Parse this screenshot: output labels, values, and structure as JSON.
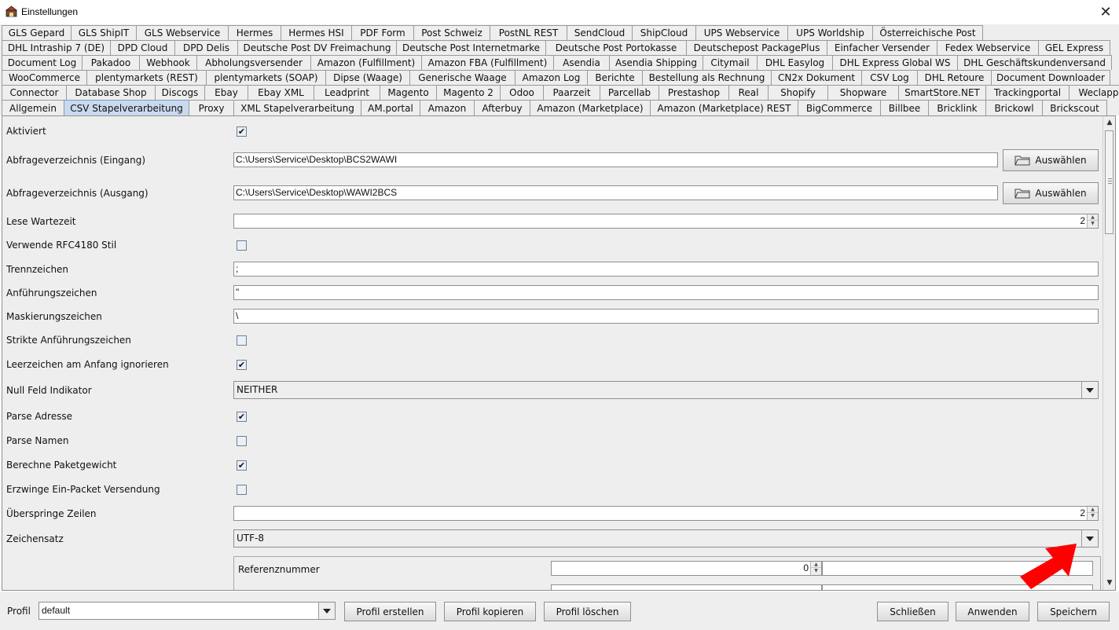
{
  "window": {
    "title": "Einstellungen",
    "close_glyph": "✕",
    "app_icon": "app-icon"
  },
  "tabs": {
    "row1": [
      "GLS Gepard",
      "GLS ShipIT",
      "GLS Webservice",
      "Hermes",
      "Hermes HSI",
      "PDF Form",
      "Post Schweiz",
      "PostNL REST",
      "SendCloud",
      "ShipCloud",
      "UPS Webservice",
      "UPS Worldship",
      "Österreichische Post"
    ],
    "row2": [
      "DHL Intraship 7 (DE)",
      "DPD Cloud",
      "DPD Delis",
      "Deutsche Post DV Freimachung",
      "Deutsche Post Internetmarke",
      "Deutsche Post Portokasse",
      "Deutschepost PackagePlus",
      "Einfacher Versender",
      "Fedex Webservice",
      "GEL Express"
    ],
    "row3": [
      "Document Log",
      "Pakadoo",
      "Webhook",
      "Abholungsversender",
      "Amazon (Fulfillment)",
      "Amazon FBA (Fulfillment)",
      "Asendia",
      "Asendia Shipping",
      "Citymail",
      "DHL Easylog",
      "DHL Express Global WS",
      "DHL Geschäftskundenversand"
    ],
    "row4": [
      "WooCommerce",
      "plentymarkets (REST)",
      "plentymarkets (SOAP)",
      "Dipse (Waage)",
      "Generische Waage",
      "Amazon Log",
      "Berichte",
      "Bestellung als Rechnung",
      "CN2x Dokument",
      "CSV Log",
      "DHL Retoure",
      "Document Downloader"
    ],
    "row5": [
      "Connector",
      "Database Shop",
      "Discogs",
      "Ebay",
      "Ebay XML",
      "Leadprint",
      "Magento",
      "Magento 2",
      "Odoo",
      "Paarzeit",
      "Parcellab",
      "Prestashop",
      "Real",
      "Shopify",
      "Shopware",
      "SmartStore.NET",
      "Trackingportal",
      "Weclapp"
    ],
    "row6": [
      "Allgemein",
      "CSV Stapelverarbeitung",
      "Proxy",
      "XML Stapelverarbeitung",
      "AM.portal",
      "Amazon",
      "Afterbuy",
      "Amazon (Marketplace)",
      "Amazon (Marketplace) REST",
      "BigCommerce",
      "Billbee",
      "Bricklink",
      "Brickowl",
      "Brickscout"
    ],
    "active": "CSV Stapelverarbeitung"
  },
  "form": {
    "aktiviert": {
      "label": "Aktiviert",
      "checked": true
    },
    "eingang": {
      "label": "Abfrageverzeichnis (Eingang)",
      "value": "C:\\Users\\Service\\Desktop\\BCS2WAWI",
      "button": "Auswählen"
    },
    "ausgang": {
      "label": "Abfrageverzeichnis (Ausgang)",
      "value": "C:\\Users\\Service\\Desktop\\WAWI2BCS",
      "button": "Auswählen"
    },
    "lese_wartezeit": {
      "label": "Lese Wartezeit",
      "value": "2"
    },
    "rfc4180": {
      "label": "Verwende RFC4180 Stil",
      "checked": false
    },
    "trennzeichen": {
      "label": "Trennzeichen",
      "value": ";"
    },
    "anfuehrungszeichen": {
      "label": "Anführungszeichen",
      "value": "\""
    },
    "maskierungszeichen": {
      "label": "Maskierungszeichen",
      "value": "\\"
    },
    "strikte": {
      "label": "Strikte Anführungszeichen",
      "checked": false
    },
    "leerzeichen": {
      "label": "Leerzeichen am Anfang ignorieren",
      "checked": true
    },
    "null_feld": {
      "label": "Null Feld Indikator",
      "value": "NEITHER"
    },
    "parse_adresse": {
      "label": "Parse Adresse",
      "checked": true
    },
    "parse_namen": {
      "label": "Parse Namen",
      "checked": false
    },
    "paketgewicht": {
      "label": "Berechne Paketgewicht",
      "checked": true
    },
    "ein_packet": {
      "label": "Erzwinge Ein-Packet Versendung",
      "checked": false
    },
    "ueberspringe": {
      "label": "Überspringe Zeilen",
      "value": "2"
    },
    "zeichensatz": {
      "label": "Zeichensatz",
      "value": "UTF-8"
    },
    "referenznummer": {
      "label": "Referenznummer",
      "value": "0"
    }
  },
  "bottom": {
    "profil_label": "Profil",
    "profil_value": "default",
    "profil_erstellen": "Profil erstellen",
    "profil_kopieren": "Profil kopieren",
    "profil_loeschen": "Profil löschen",
    "schliessen": "Schließen",
    "anwenden": "Anwenden",
    "speichern": "Speichern"
  },
  "colors": {
    "active_tab": "#c9daef",
    "annotation_arrow": "#ff0000"
  },
  "icons": {
    "check": "✔",
    "spin_up": "▲",
    "spin_down": "▼"
  }
}
